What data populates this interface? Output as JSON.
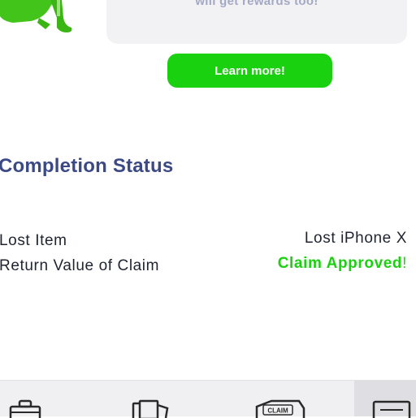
{
  "promo": {
    "card_text": "will get rewards too!",
    "learn_more_label": "Learn more!"
  },
  "completion": {
    "title": "Completion Status",
    "rows": [
      {
        "label": "Lost Item",
        "value": "Lost iPhone X"
      },
      {
        "label": "Return Value of Claim",
        "value": "Claim Approved",
        "value_suffix": "!"
      }
    ]
  },
  "tabbar": {
    "claim_badge": "CLAIM",
    "tabs": [
      {
        "icon": "briefcase-icon"
      },
      {
        "icon": "documents-icon"
      },
      {
        "icon": "claim-ticket-icon"
      },
      {
        "icon": "message-icon",
        "active": true
      }
    ]
  },
  "colors": {
    "accent_green": "#1ad10f",
    "title_navy": "#3b4a86",
    "card_bg": "#f2f2f4"
  }
}
